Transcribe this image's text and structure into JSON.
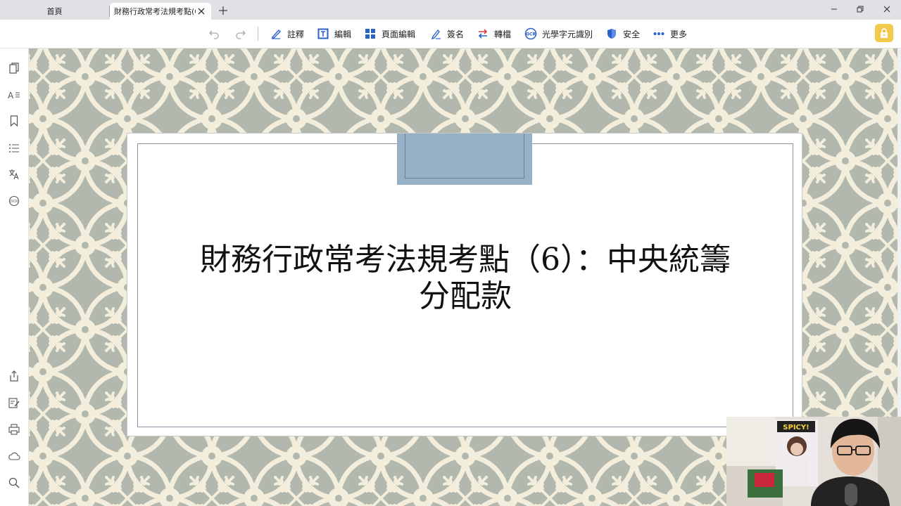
{
  "tabs": [
    {
      "label": "首頁"
    },
    {
      "label": "財務行政常考法規考點(6..."
    }
  ],
  "toolbar": {
    "items": [
      {
        "label": "註釋",
        "icon": "pen-annotate-icon"
      },
      {
        "label": "編輯",
        "icon": "edit-text-icon"
      },
      {
        "label": "頁面編輯",
        "icon": "grid-pages-icon"
      },
      {
        "label": "簽名",
        "icon": "sign-pen-icon"
      },
      {
        "label": "轉檔",
        "icon": "convert-arrows-icon"
      },
      {
        "label": "光學字元識別",
        "icon": "ocr-icon"
      },
      {
        "label": "安全",
        "icon": "shield-icon"
      },
      {
        "label": "更多",
        "icon": "more-dots-icon"
      }
    ]
  },
  "slide": {
    "title_line1": "財務行政常考法規考點（6）：中央統籌",
    "title_line2": "分配款"
  },
  "colors": {
    "accent_blue": "#2a62c9",
    "pattern_bg": "#b2b8ae",
    "pattern_fg": "#f3eedc",
    "slide_tab": "#96b0c6",
    "premium": "#f2c94c"
  }
}
